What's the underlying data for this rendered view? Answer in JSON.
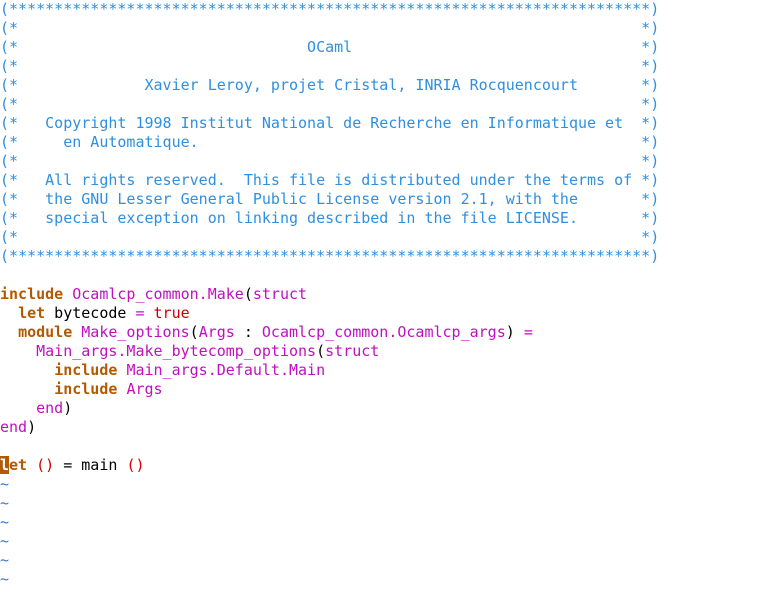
{
  "editor": {
    "colors": {
      "background": "#ffffff",
      "comment": "#2f8fe0",
      "keyword": "#b35a00",
      "module": "#c010c0",
      "boolean": "#d00000",
      "paren": "#d00000",
      "tilde": "#3a78d0",
      "cursor_bg": "#b35a00"
    },
    "lines": [
      [
        {
          "t": "comment",
          "v": "(***********************************************************************)"
        }
      ],
      [
        {
          "t": "comment",
          "v": "(*                                                                     *)"
        }
      ],
      [
        {
          "t": "comment",
          "v": "(*                                OCaml                                *)"
        }
      ],
      [
        {
          "t": "comment",
          "v": "(*                                                                     *)"
        }
      ],
      [
        {
          "t": "comment",
          "v": "(*              Xavier Leroy, projet Cristal, INRIA Rocquencourt       *)"
        }
      ],
      [
        {
          "t": "comment",
          "v": "(*                                                                     *)"
        }
      ],
      [
        {
          "t": "comment",
          "v": "(*   Copyright 1998 Institut National de Recherche en Informatique et  *)"
        }
      ],
      [
        {
          "t": "comment",
          "v": "(*     en Automatique.                                                 *)"
        }
      ],
      [
        {
          "t": "comment",
          "v": "(*                                                                     *)"
        }
      ],
      [
        {
          "t": "comment",
          "v": "(*   All rights reserved.  This file is distributed under the terms of *)"
        }
      ],
      [
        {
          "t": "comment",
          "v": "(*   the GNU Lesser General Public License version 2.1, with the       *)"
        }
      ],
      [
        {
          "t": "comment",
          "v": "(*   special exception on linking described in the file LICENSE.       *)"
        }
      ],
      [
        {
          "t": "comment",
          "v": "(*                                                                     *)"
        }
      ],
      [
        {
          "t": "comment",
          "v": "(***********************************************************************)"
        }
      ],
      [],
      [
        {
          "t": "keyword",
          "v": "include"
        },
        {
          "t": "ident",
          "v": " "
        },
        {
          "t": "module",
          "v": "Ocamlcp_common.Make"
        },
        {
          "t": "ident",
          "v": "("
        },
        {
          "t": "module",
          "v": "struct"
        }
      ],
      [
        {
          "t": "ident",
          "v": "  "
        },
        {
          "t": "keyword",
          "v": "let"
        },
        {
          "t": "ident",
          "v": " bytecode "
        },
        {
          "t": "operator",
          "v": "="
        },
        {
          "t": "ident",
          "v": " "
        },
        {
          "t": "boolean",
          "v": "true"
        }
      ],
      [
        {
          "t": "ident",
          "v": "  "
        },
        {
          "t": "keyword",
          "v": "module"
        },
        {
          "t": "ident",
          "v": " "
        },
        {
          "t": "module",
          "v": "Make_options"
        },
        {
          "t": "ident",
          "v": "("
        },
        {
          "t": "module",
          "v": "Args"
        },
        {
          "t": "ident",
          "v": " : "
        },
        {
          "t": "module",
          "v": "Ocamlcp_common.Ocamlcp_args"
        },
        {
          "t": "ident",
          "v": ") "
        },
        {
          "t": "operator",
          "v": "="
        }
      ],
      [
        {
          "t": "ident",
          "v": "    "
        },
        {
          "t": "module",
          "v": "Main_args.Make_bytecomp_options"
        },
        {
          "t": "ident",
          "v": "("
        },
        {
          "t": "module",
          "v": "struct"
        }
      ],
      [
        {
          "t": "ident",
          "v": "      "
        },
        {
          "t": "keyword",
          "v": "include"
        },
        {
          "t": "ident",
          "v": " "
        },
        {
          "t": "module",
          "v": "Main_args.Default.Main"
        }
      ],
      [
        {
          "t": "ident",
          "v": "      "
        },
        {
          "t": "keyword",
          "v": "include"
        },
        {
          "t": "ident",
          "v": " "
        },
        {
          "t": "module",
          "v": "Args"
        }
      ],
      [
        {
          "t": "ident",
          "v": "    "
        },
        {
          "t": "module",
          "v": "end"
        },
        {
          "t": "ident",
          "v": ")"
        }
      ],
      [
        {
          "t": "module",
          "v": "end"
        },
        {
          "t": "ident",
          "v": ")"
        }
      ],
      [],
      [
        {
          "t": "cursor",
          "v": "l"
        },
        {
          "t": "keyword",
          "v": "et"
        },
        {
          "t": "ident",
          "v": " "
        },
        {
          "t": "paren",
          "v": "()"
        },
        {
          "t": "ident",
          "v": " = main "
        },
        {
          "t": "paren",
          "v": "()"
        }
      ],
      [
        {
          "t": "tilde",
          "v": "~"
        }
      ],
      [
        {
          "t": "tilde",
          "v": "~"
        }
      ],
      [
        {
          "t": "tilde",
          "v": "~"
        }
      ],
      [
        {
          "t": "tilde",
          "v": "~"
        }
      ],
      [
        {
          "t": "tilde",
          "v": "~"
        }
      ],
      [
        {
          "t": "tilde",
          "v": "~"
        }
      ]
    ]
  }
}
